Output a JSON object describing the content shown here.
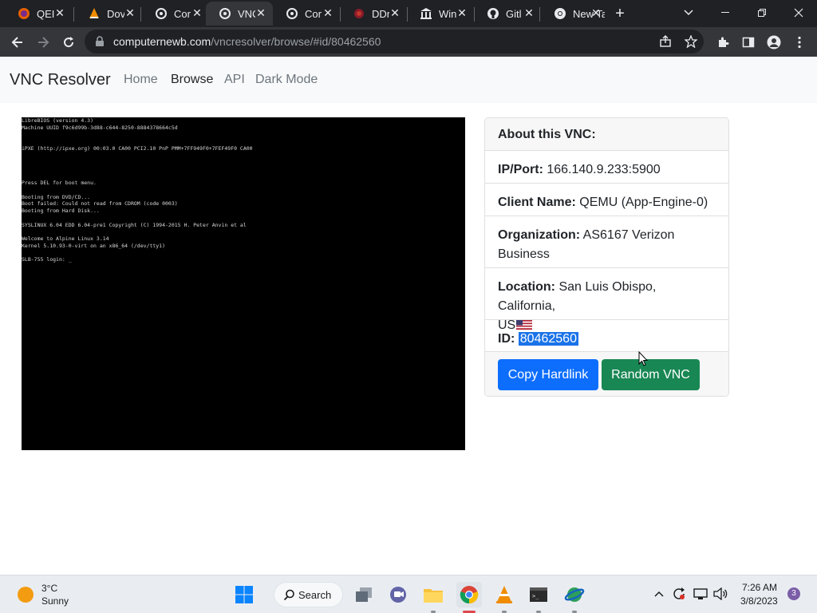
{
  "browser": {
    "tabs": [
      {
        "label": "QEI",
        "icon": "firefox-icon",
        "active": false
      },
      {
        "label": "Dov",
        "icon": "vlc-icon",
        "active": false
      },
      {
        "label": "Cor",
        "icon": "vnc-resolver-icon",
        "active": false
      },
      {
        "label": "VNC",
        "icon": "vnc-resolver-icon",
        "active": true
      },
      {
        "label": "Cor",
        "icon": "vnc-resolver-icon",
        "active": false
      },
      {
        "label": "DDr",
        "icon": "ddr-icon",
        "active": false
      },
      {
        "label": "Win",
        "icon": "bank-icon",
        "active": false
      },
      {
        "label": "Gitl",
        "icon": "github-icon",
        "active": false
      },
      {
        "label": "New Tab",
        "icon": "chrome-icon",
        "active": false
      }
    ],
    "url_host": "computernewb.com",
    "url_path": "/vncresolver/browse/#id/80462560"
  },
  "site": {
    "brand": "VNC Resolver",
    "nav": [
      "Home",
      "Browse",
      "API",
      "Dark Mode"
    ],
    "active_nav": "Browse"
  },
  "vnc_screen": {
    "lines": [
      "LibreBIOS (version 4.3)",
      "Machine UUID f9c6d99b-3d88-c644-8250-8884378664c5d",
      "",
      "",
      "iPXE (http://ipxe.org) 00:03.0 CA00 PCI2.10 PnP PMM+7FF949F0+7FEF49F0 CA00",
      "",
      "",
      "",
      "",
      "Press DEL for boot menu.",
      "",
      "Booting from DVD/CD...",
      "Boot failed: Could not read from CDROM (code 0003)",
      "Booting from Hard Disk...",
      "",
      "SYSLINUX 6.04 EDD 6.04-pre1 Copyright (C) 1994-2015 H. Peter Anvin et al",
      "",
      "Welcome to Alpine Linux 3.14",
      "Kernel 5.10.93-0-virt on an x86_64 (/dev/tty1)",
      "",
      "SLB-755 login: _"
    ]
  },
  "card": {
    "header": "About this VNC:",
    "ip_label": "IP/Port:",
    "ip_value": "166.140.9.233:5900",
    "client_label": "Client Name:",
    "client_value": "QEMU (App-Engine-0)",
    "org_label": "Organization:",
    "org_value_line1": "AS6167 Verizon",
    "org_value_line2": "Business",
    "location_label": "Location:",
    "location_value_line1": "San Luis Obispo, California,",
    "location_value_line2": "US",
    "id_label": "ID:",
    "id_value": "80462560",
    "copy_button": "Copy Hardlink",
    "random_button": "Random VNC"
  },
  "taskbar": {
    "weather_temp": "3°C",
    "weather_desc": "Sunny",
    "search_label": "Search",
    "time": "7:26 AM",
    "date": "3/8/2023",
    "notification_count": "3"
  },
  "colors": {
    "primary": "#0d6efd",
    "success": "#198754",
    "selection": "#1a73e8",
    "chrome_dark": "#202124",
    "chrome_toolbar": "#35363a"
  }
}
